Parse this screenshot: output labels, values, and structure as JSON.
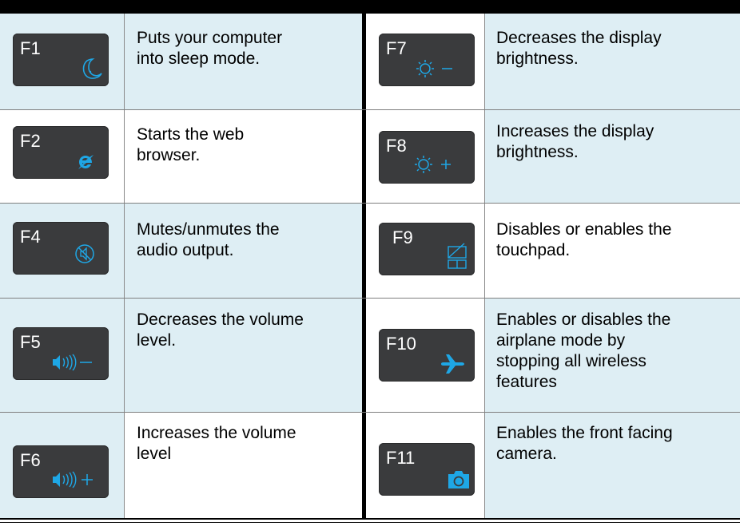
{
  "rows": [
    {
      "left": {
        "key": "F1",
        "icon": "sleep-moon-icon",
        "desc": "Puts your computer\ninto sleep mode."
      },
      "right": {
        "key": "F7",
        "icon": "brightness-down-icon",
        "desc": "Decreases the display\nbrightness."
      }
    },
    {
      "left": {
        "key": "F2",
        "icon": "web-browser-icon",
        "desc": "Starts the web\nbrowser."
      },
      "right": {
        "key": "F8",
        "icon": "brightness-up-icon",
        "desc": "Increases the display\nbrightness."
      }
    },
    {
      "left": {
        "key": "F4",
        "icon": "mute-icon",
        "desc": "Mutes/unmutes the\naudio output."
      },
      "right": {
        "key": "F9",
        "icon": "touchpad-toggle-icon",
        "desc": "Disables or enables the\ntouchpad."
      }
    },
    {
      "left": {
        "key": "F5",
        "icon": "volume-down-icon",
        "desc": "Decreases the volume\nlevel."
      },
      "right": {
        "key": "F10",
        "icon": "airplane-icon",
        "desc": "Enables or disables the\nairplane mode by\nstopping all wireless\nfeatures"
      }
    },
    {
      "left": {
        "key": "F6",
        "icon": "volume-up-icon",
        "desc": "Increases the volume\nlevel"
      },
      "right": {
        "key": "F11",
        "icon": "camera-icon",
        "desc": "Enables the front facing\ncamera."
      }
    }
  ],
  "colors": {
    "key_background": "#3a3b3d",
    "icon_accent": "#1ea7e6",
    "cell_tint": "#deeef4"
  }
}
